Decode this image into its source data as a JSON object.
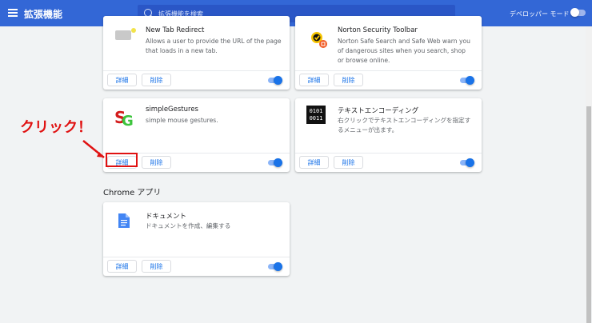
{
  "topbar": {
    "title": "拡張機能",
    "search_placeholder": "拡張機能を検索",
    "dev_mode_label": "デベロッパー モード"
  },
  "cards": [
    {
      "name": "New Tab Redirect",
      "description": "Allows a user to provide the URL of the page that loads in a new tab.",
      "details": "詳細",
      "remove": "削除"
    },
    {
      "name": "Norton Security Toolbar",
      "description": "Norton Safe Search and Safe Web warn you of dangerous sites when you search, shop or browse online.",
      "details": "詳細",
      "remove": "削除"
    },
    {
      "name": "simpleGestures",
      "description": "simple mouse gestures.",
      "details": "詳細",
      "remove": "削除"
    },
    {
      "name": "テキストエンコーディング",
      "description": "右クリックでテキストエンコーディングを指定するメニューが出ます。",
      "details": "詳細",
      "remove": "削除",
      "icon_text": [
        "0101",
        "0011"
      ]
    },
    {
      "name": "ドキュメント",
      "description": "ドキュメントを作成、編集する",
      "details": "詳細",
      "remove": "削除"
    }
  ],
  "section": {
    "chrome_apps": "Chrome アプリ"
  },
  "annotation": {
    "text": "クリック！"
  }
}
